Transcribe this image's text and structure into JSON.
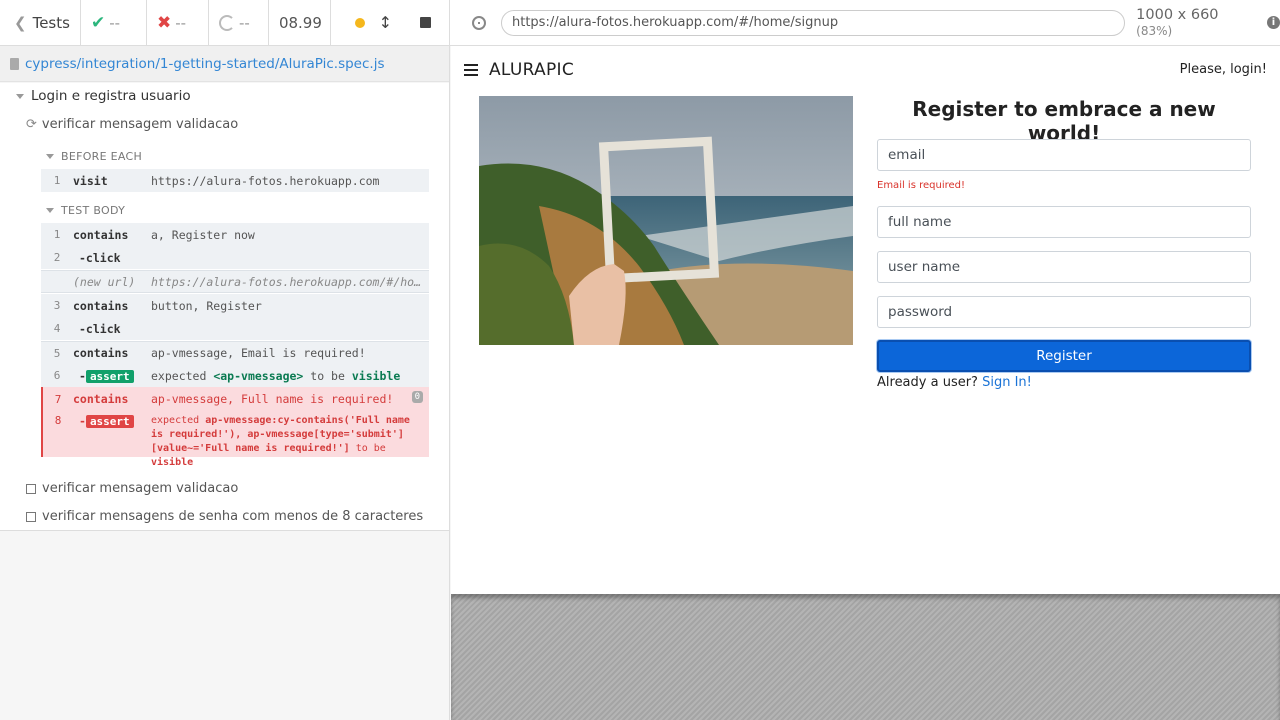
{
  "stats": {
    "tests_label": "Tests",
    "passed": "--",
    "failed": "--",
    "pending": "--",
    "duration": "08.99"
  },
  "spec": {
    "path": "cypress/integration/1-getting-started/AluraPic.spec.js"
  },
  "suite": {
    "title": "Login e registra usuario",
    "test_running": "verificar mensagem validacao",
    "before_each_label": "BEFORE EACH",
    "test_body_label": "TEST BODY",
    "before_each": [
      {
        "num": "1",
        "name": "visit",
        "msg": "https://alura-fotos.herokuapp.com"
      }
    ],
    "commands": [
      {
        "num": "1",
        "name": "contains",
        "msg": "a, Register now"
      },
      {
        "num": "2",
        "name": "-click",
        "msg": ""
      },
      {
        "num": "",
        "name": "(new url)",
        "msg": "https://alura-fotos.herokuapp.com/#/home/signup"
      },
      {
        "num": "3",
        "name": "contains",
        "msg": "button, Register"
      },
      {
        "num": "4",
        "name": "-click",
        "msg": ""
      },
      {
        "num": "5",
        "name": "contains",
        "msg": "ap-vmessage, Email is required!"
      },
      {
        "num": "6",
        "name": "assert",
        "msg_pre": "expected",
        "msg_el": "<ap-vmessage>",
        "msg_mid": "to be",
        "msg_end": "visible"
      },
      {
        "num": "7",
        "name": "contains",
        "msg": "ap-vmessage, Full name is required!",
        "count": "0"
      },
      {
        "num": "8",
        "name": "assert",
        "msg_pre": "expected",
        "msg_el": "ap-vmessage:cy-contains('Full name is required!'), ap-vmessage[type='submit'][value~='Full name is required!']",
        "msg_mid": "to be",
        "msg_end": "visible"
      }
    ],
    "pending_tests": [
      "verificar mensagem validacao",
      "verificar mensagens de senha com menos de 8 caracteres"
    ]
  },
  "browser": {
    "url": "https://alura-fotos.herokuapp.com/#/home/signup",
    "viewport": "1000 x 660",
    "zoom": "(83%)"
  },
  "app": {
    "brand": "ALURAPIC",
    "login_link": "Please, login!",
    "form_title": "Register to embrace a new world!",
    "email_placeholder": "email",
    "email_error": "Email is required!",
    "fullname_placeholder": "full name",
    "username_placeholder": "user name",
    "password_placeholder": "password",
    "register_label": "Register",
    "already_text": "Already a user?",
    "signin_link": "Sign In!"
  }
}
